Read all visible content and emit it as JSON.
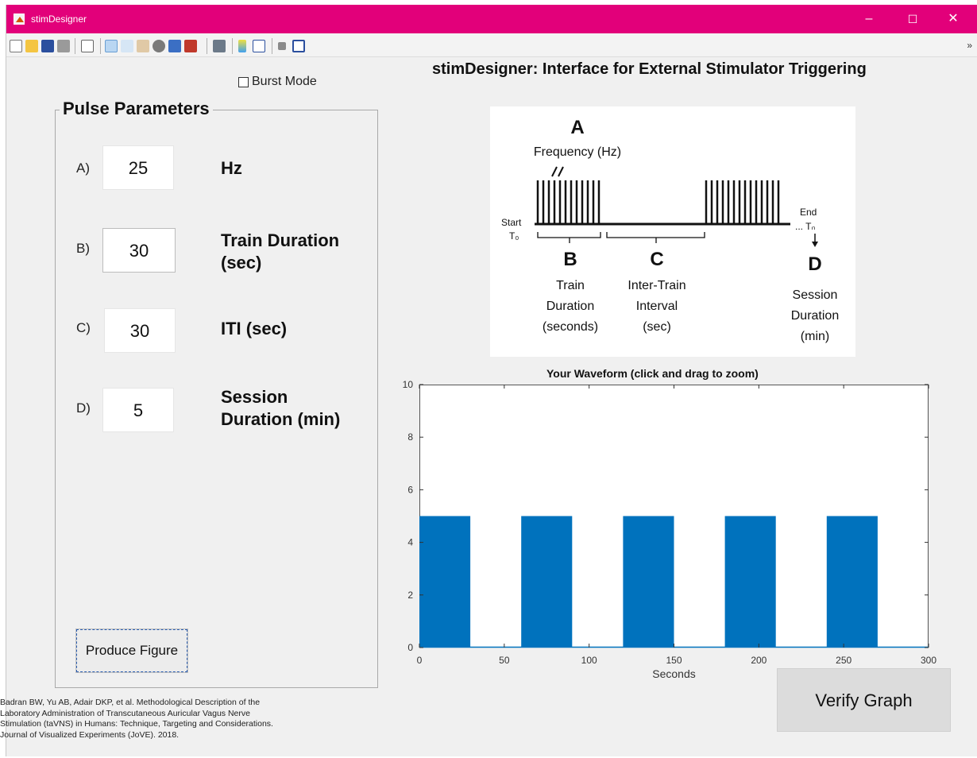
{
  "window": {
    "title": "stimDesigner",
    "controls": [
      "–",
      "☐",
      "✕"
    ]
  },
  "toolbar": {
    "icons": [
      "new-file-icon",
      "open-folder-icon",
      "save-icon",
      "print-icon",
      "pointer-icon",
      "zoom-in-icon",
      "zoom-out-icon",
      "pan-icon",
      "rotate-3d-icon",
      "data-cursor-icon",
      "brush-icon",
      "link-plot-icon",
      "colorbar-icon",
      "legend-icon",
      "hide-plot-tools-icon",
      "show-plot-tools-icon"
    ],
    "overflow": "»"
  },
  "heading": "stimDesigner: Interface for External Stimulator Triggering",
  "burst_mode": {
    "label": "Burst Mode",
    "checked": false
  },
  "pulse_panel": {
    "title": "Pulse Parameters",
    "params": [
      {
        "label": "A)",
        "value": "25",
        "unit": "Hz"
      },
      {
        "label": "B)",
        "value": "30",
        "unit_line1": "Train Duration",
        "unit_line2": "(sec)"
      },
      {
        "label": "C)",
        "value": "30",
        "unit": "ITI (sec)"
      },
      {
        "label": "D)",
        "value": "5",
        "unit_line1": "Session",
        "unit_line2": "Duration (min)"
      }
    ],
    "produce_button": "Produce Figure"
  },
  "citation": [
    "Badran BW, Yu AB, Adair DKP, et al. Methodological Description of the",
    "Laboratory Administration of Transcutaneous Auricular Vagus Nerve",
    "Stimulation (taVNS) in Humans: Technique, Targeting and Considerations.",
    "Journal of Visualized Experiments (JoVE). 2018."
  ],
  "diagram": {
    "A": "A",
    "A_text": "Frequency (Hz)",
    "start": "Start",
    "t0": "T₀",
    "end": "End",
    "tn": "... Tₙ",
    "B": "B",
    "B_text": [
      "Train",
      "Duration",
      "(seconds)"
    ],
    "C": "C",
    "C_text": [
      "Inter-Train",
      "Interval",
      "(sec)"
    ],
    "D": "D",
    "D_text": [
      "Session",
      "Duration",
      "(min)"
    ]
  },
  "chart_data": {
    "type": "area",
    "title": "Your Waveform (click and drag to zoom)",
    "xlabel": "Seconds",
    "ylabel": "",
    "xlim": [
      0,
      300
    ],
    "ylim": [
      0,
      10
    ],
    "xticks": [
      0,
      50,
      100,
      150,
      200,
      250,
      300
    ],
    "yticks": [
      0,
      2,
      4,
      6,
      8,
      10
    ],
    "grid": false,
    "color": "#0072bd",
    "blocks": [
      {
        "x_start": 0,
        "x_end": 30,
        "y": 5
      },
      {
        "x_start": 60,
        "x_end": 90,
        "y": 5
      },
      {
        "x_start": 120,
        "x_end": 150,
        "y": 5
      },
      {
        "x_start": 180,
        "x_end": 210,
        "y": 5
      },
      {
        "x_start": 240,
        "x_end": 270,
        "y": 5
      }
    ]
  },
  "verify_button": "Verify Graph"
}
